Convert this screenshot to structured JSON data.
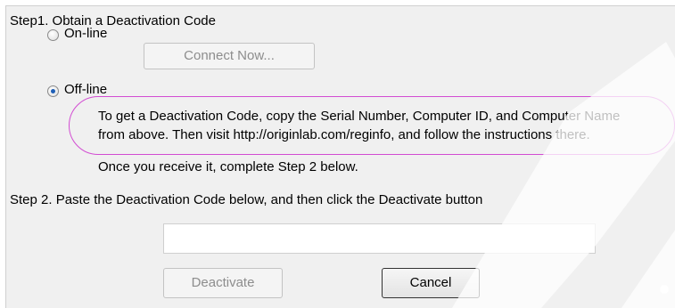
{
  "step1": {
    "heading": "Step1. Obtain a Deactivation Code",
    "online_label": "On-line",
    "connect_button": "Connect Now...",
    "offline_label": "Off-line",
    "selected": "offline",
    "instructions_line1": "To get a Deactivation Code, copy the Serial Number, Computer ID, and Computer Name",
    "instructions_line2": "from above. Then visit  http://originlab.com/reginfo, and follow the instructions there.",
    "followup": "Once you receive it, complete Step 2 below."
  },
  "step2": {
    "heading": "Step 2. Paste the Deactivation Code below, and then click the Deactivate button",
    "code_value": "",
    "deactivate_button": "Deactivate",
    "cancel_button": "Cancel"
  },
  "colors": {
    "callout_border": "#d24cd2",
    "radio_dot": "#1f5fb7"
  }
}
